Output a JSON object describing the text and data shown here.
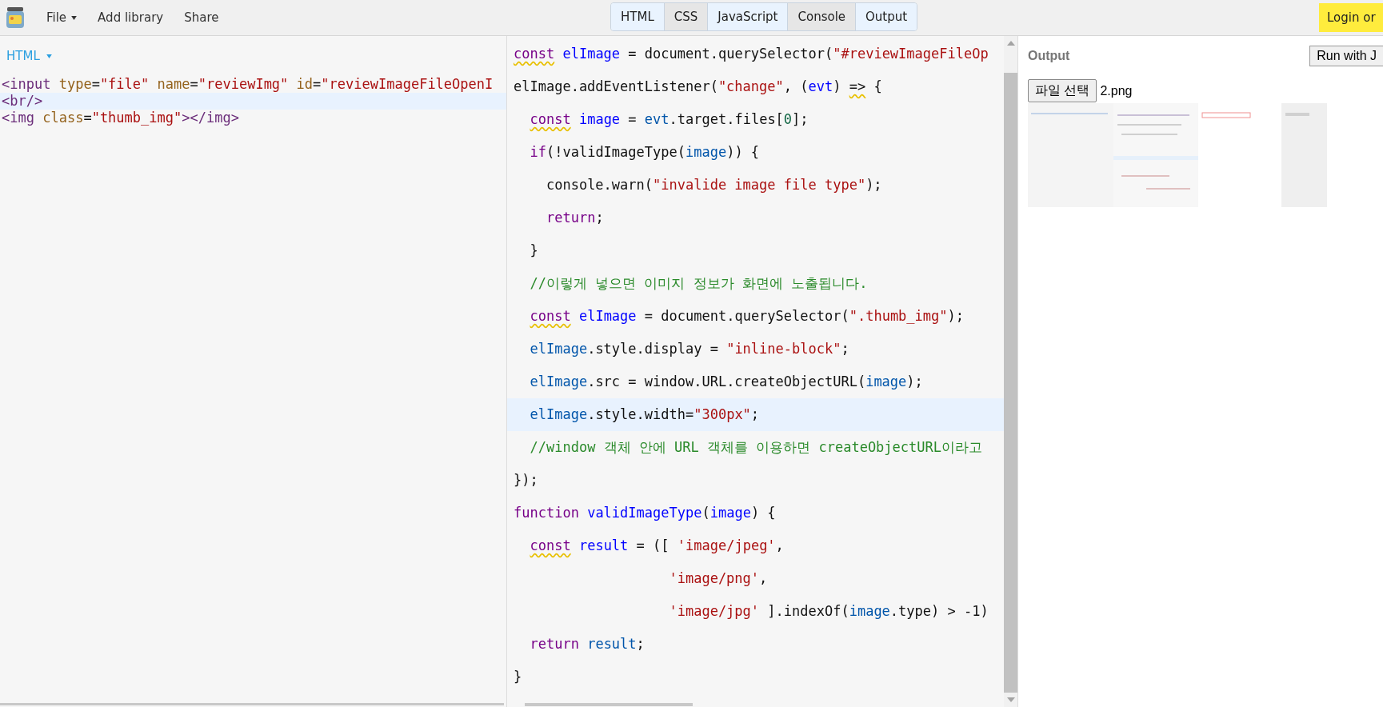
{
  "toolbar": {
    "menus": [
      {
        "label": "File",
        "dropdown": true
      },
      {
        "label": "Add library",
        "dropdown": false
      },
      {
        "label": "Share",
        "dropdown": false
      }
    ],
    "tabs": [
      {
        "label": "HTML",
        "selected": true
      },
      {
        "label": "CSS",
        "selected": false
      },
      {
        "label": "JavaScript",
        "selected": true
      },
      {
        "label": "Console",
        "selected": false
      },
      {
        "label": "Output",
        "selected": true
      }
    ],
    "login_button": "Login or"
  },
  "html_panel": {
    "title": "HTML",
    "lines": [
      {
        "active": false,
        "tokens": [
          {
            "text": "<input",
            "kind": "tag"
          },
          {
            "text": " type",
            "kind": "attr"
          },
          {
            "text": "=",
            "kind": "plain"
          },
          {
            "text": "\"file\"",
            "kind": "string"
          },
          {
            "text": " name",
            "kind": "attr"
          },
          {
            "text": "=",
            "kind": "plain"
          },
          {
            "text": "\"reviewImg\"",
            "kind": "string"
          },
          {
            "text": " id",
            "kind": "attr"
          },
          {
            "text": "=",
            "kind": "plain"
          },
          {
            "text": "\"reviewImageFileOpenI",
            "kind": "string"
          }
        ]
      },
      {
        "active": true,
        "tokens": [
          {
            "text": "<br/>",
            "kind": "tag"
          }
        ]
      },
      {
        "active": false,
        "tokens": [
          {
            "text": "<img",
            "kind": "tag"
          },
          {
            "text": " class",
            "kind": "attr"
          },
          {
            "text": "=",
            "kind": "plain"
          },
          {
            "text": "\"thumb_img\"",
            "kind": "string"
          },
          {
            "text": "></img>",
            "kind": "tag"
          }
        ]
      }
    ]
  },
  "js_panel": {
    "lines": [
      {
        "active": false,
        "tokens": [
          {
            "text": "const",
            "kind": "keyword",
            "warn": true
          },
          {
            "text": " elImage",
            "kind": "def"
          },
          {
            "text": " = document.querySelector(",
            "kind": "plain"
          },
          {
            "text": "\"#reviewImageFileOp",
            "kind": "string"
          }
        ]
      },
      {
        "active": false,
        "tokens": [
          {
            "text": "elImage.addEventListener(",
            "kind": "plain"
          },
          {
            "text": "\"change\"",
            "kind": "string"
          },
          {
            "text": ", (",
            "kind": "plain"
          },
          {
            "text": "evt",
            "kind": "def"
          },
          {
            "text": ")",
            "kind": "plain"
          },
          {
            "text": " =>",
            "kind": "plain",
            "warn": true
          },
          {
            "text": " {",
            "kind": "plain"
          }
        ]
      },
      {
        "active": false,
        "tokens": [
          {
            "text": "  const",
            "kind": "keyword",
            "warn": true
          },
          {
            "text": " image",
            "kind": "def"
          },
          {
            "text": " = ",
            "kind": "plain"
          },
          {
            "text": "evt",
            "kind": "variable"
          },
          {
            "text": ".target.files[",
            "kind": "plain"
          },
          {
            "text": "0",
            "kind": "number"
          },
          {
            "text": "];",
            "kind": "plain"
          }
        ]
      },
      {
        "active": false,
        "tokens": [
          {
            "text": "  if",
            "kind": "keyword"
          },
          {
            "text": "(!validImageType(",
            "kind": "plain"
          },
          {
            "text": "image",
            "kind": "variable"
          },
          {
            "text": ")) {",
            "kind": "plain"
          }
        ]
      },
      {
        "active": false,
        "tokens": [
          {
            "text": "    console.warn(",
            "kind": "plain"
          },
          {
            "text": "\"invalide image file type\"",
            "kind": "string"
          },
          {
            "text": ");",
            "kind": "plain"
          }
        ]
      },
      {
        "active": false,
        "tokens": [
          {
            "text": "    return",
            "kind": "keyword"
          },
          {
            "text": ";",
            "kind": "plain"
          }
        ]
      },
      {
        "active": false,
        "tokens": [
          {
            "text": "  }",
            "kind": "plain"
          }
        ]
      },
      {
        "active": false,
        "tokens": [
          {
            "text": "  //이렇게 넣으면 이미지 정보가 화면에 노출됩니다.",
            "kind": "comment"
          }
        ]
      },
      {
        "active": false,
        "tokens": [
          {
            "text": "  const",
            "kind": "keyword",
            "warn": true
          },
          {
            "text": " elImage",
            "kind": "def"
          },
          {
            "text": " = document.querySelector(",
            "kind": "plain"
          },
          {
            "text": "\".thumb_img\"",
            "kind": "string"
          },
          {
            "text": ");",
            "kind": "plain"
          }
        ]
      },
      {
        "active": false,
        "tokens": [
          {
            "text": "  elImage",
            "kind": "variable"
          },
          {
            "text": ".style.display = ",
            "kind": "plain"
          },
          {
            "text": "\"inline-block\"",
            "kind": "string"
          },
          {
            "text": ";",
            "kind": "plain"
          }
        ]
      },
      {
        "active": false,
        "tokens": [
          {
            "text": "  elImage",
            "kind": "variable"
          },
          {
            "text": ".src = window.URL.createObjectURL(",
            "kind": "plain"
          },
          {
            "text": "image",
            "kind": "variable"
          },
          {
            "text": ");",
            "kind": "plain"
          }
        ]
      },
      {
        "active": true,
        "tokens": [
          {
            "text": "  elImage",
            "kind": "variable"
          },
          {
            "text": ".style.width=",
            "kind": "plain"
          },
          {
            "text": "\"300px\"",
            "kind": "string"
          },
          {
            "text": ";",
            "kind": "plain"
          }
        ]
      },
      {
        "active": false,
        "tokens": [
          {
            "text": "  //window 객체 안에 URL 객체를 이용하면 createObjectURL이라고",
            "kind": "comment"
          }
        ]
      },
      {
        "active": false,
        "tokens": [
          {
            "text": "});",
            "kind": "plain"
          }
        ]
      },
      {
        "active": false,
        "tokens": [
          {
            "text": "function",
            "kind": "keyword"
          },
          {
            "text": " validImageType",
            "kind": "def"
          },
          {
            "text": "(",
            "kind": "plain"
          },
          {
            "text": "image",
            "kind": "def"
          },
          {
            "text": ") {",
            "kind": "plain"
          }
        ]
      },
      {
        "active": false,
        "tokens": [
          {
            "text": "  const",
            "kind": "keyword",
            "warn": true
          },
          {
            "text": " result",
            "kind": "def"
          },
          {
            "text": " = ([ ",
            "kind": "plain"
          },
          {
            "text": "'image/jpeg'",
            "kind": "string"
          },
          {
            "text": ",",
            "kind": "plain"
          }
        ]
      },
      {
        "active": false,
        "tokens": [
          {
            "text": "                   'image/png'",
            "kind": "string"
          },
          {
            "text": ",",
            "kind": "plain"
          }
        ]
      },
      {
        "active": false,
        "tokens": [
          {
            "text": "                   'image/jpg'",
            "kind": "string"
          },
          {
            "text": " ].indexOf(",
            "kind": "plain"
          },
          {
            "text": "image",
            "kind": "variable"
          },
          {
            "text": ".type) > -1)",
            "kind": "plain"
          }
        ]
      },
      {
        "active": false,
        "tokens": [
          {
            "text": "  return",
            "kind": "keyword"
          },
          {
            "text": " result",
            "kind": "variable"
          },
          {
            "text": ";",
            "kind": "plain"
          }
        ]
      },
      {
        "active": false,
        "tokens": [
          {
            "text": "}",
            "kind": "plain"
          }
        ]
      }
    ]
  },
  "output_panel": {
    "title": "Output",
    "run_button": "Run with J",
    "file_button": "파일 선택",
    "file_name": "2.png"
  }
}
